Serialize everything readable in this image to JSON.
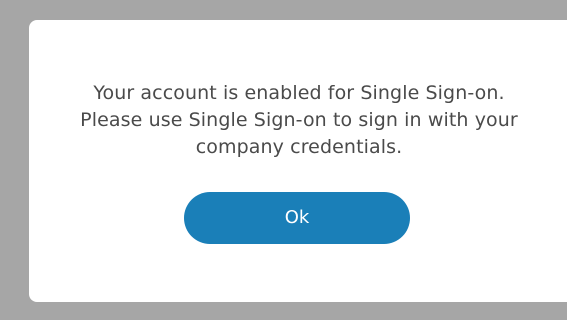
{
  "dialog": {
    "message": "Your account is enabled for Single Sign-on. Please use Single Sign-on to sign in with your company credentials.",
    "ok_label": "Ok"
  },
  "colors": {
    "overlay": "#a6a6a6",
    "dialog_background": "#ffffff",
    "text": "#4a4a4a",
    "button_background": "#1a7fb8",
    "button_text": "#ffffff"
  }
}
